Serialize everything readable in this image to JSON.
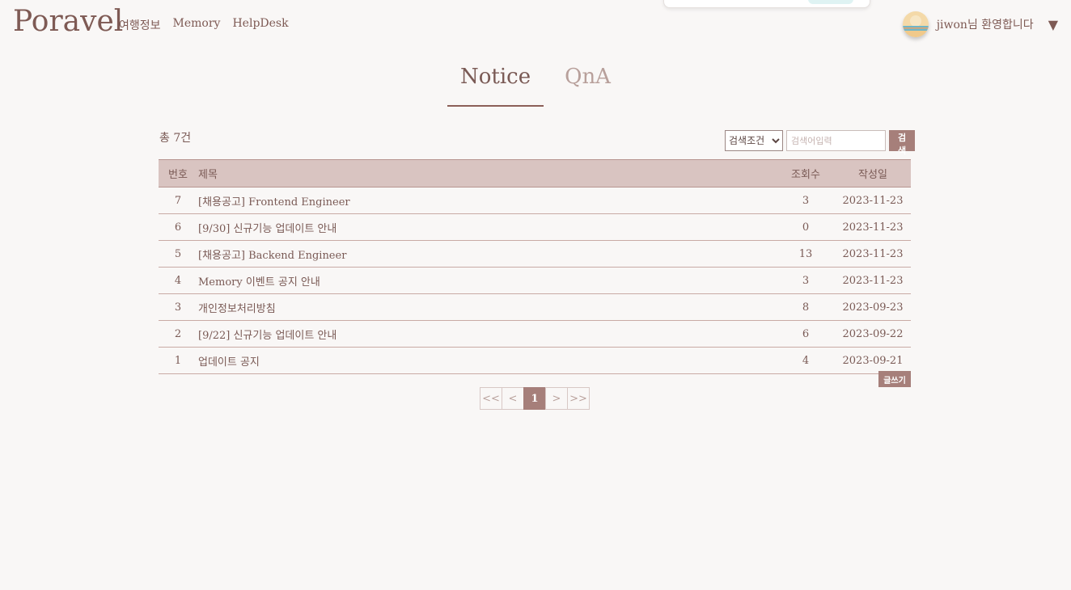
{
  "header": {
    "logo": "Poravel",
    "nav": [
      "여행정보",
      "Memory",
      "HelpDesk"
    ],
    "user_greeting": "jiwon님 환영합니다",
    "dropdown_caret": "▼"
  },
  "tabs": {
    "notice": "Notice",
    "qna": "QnA"
  },
  "board": {
    "total_text": "총 7건",
    "search": {
      "select_label": "검색조건",
      "placeholder": "검색어입력",
      "button": "검색"
    },
    "columns": {
      "num": "번호",
      "title": "제목",
      "views": "조회수",
      "date": "작성일"
    },
    "rows": [
      {
        "num": "7",
        "title": "[채용공고] Frontend Engineer",
        "views": "3",
        "date": "2023-11-23"
      },
      {
        "num": "6",
        "title": "[9/30] 신규기능 업데이트 안내",
        "views": "0",
        "date": "2023-11-23"
      },
      {
        "num": "5",
        "title": "[채용공고] Backend Engineer",
        "views": "13",
        "date": "2023-11-23"
      },
      {
        "num": "4",
        "title": "Memory 이벤트 공지 안내",
        "views": "3",
        "date": "2023-11-23"
      },
      {
        "num": "3",
        "title": "개인정보처리방침",
        "views": "8",
        "date": "2023-09-23"
      },
      {
        "num": "2",
        "title": "[9/22] 신규기능 업데이트 안내",
        "views": "6",
        "date": "2023-09-22"
      },
      {
        "num": "1",
        "title": "업데이트 공지",
        "views": "4",
        "date": "2023-09-21"
      }
    ],
    "write_button": "글쓰기"
  },
  "pagination": {
    "first": "<<",
    "prev": "<",
    "current": "1",
    "next": ">",
    "last": ">>"
  },
  "colors": {
    "accent": "#a67f7a",
    "header_bg": "#d9c4c1",
    "text": "#7a5a55",
    "page_bg": "#f9f7f6"
  }
}
